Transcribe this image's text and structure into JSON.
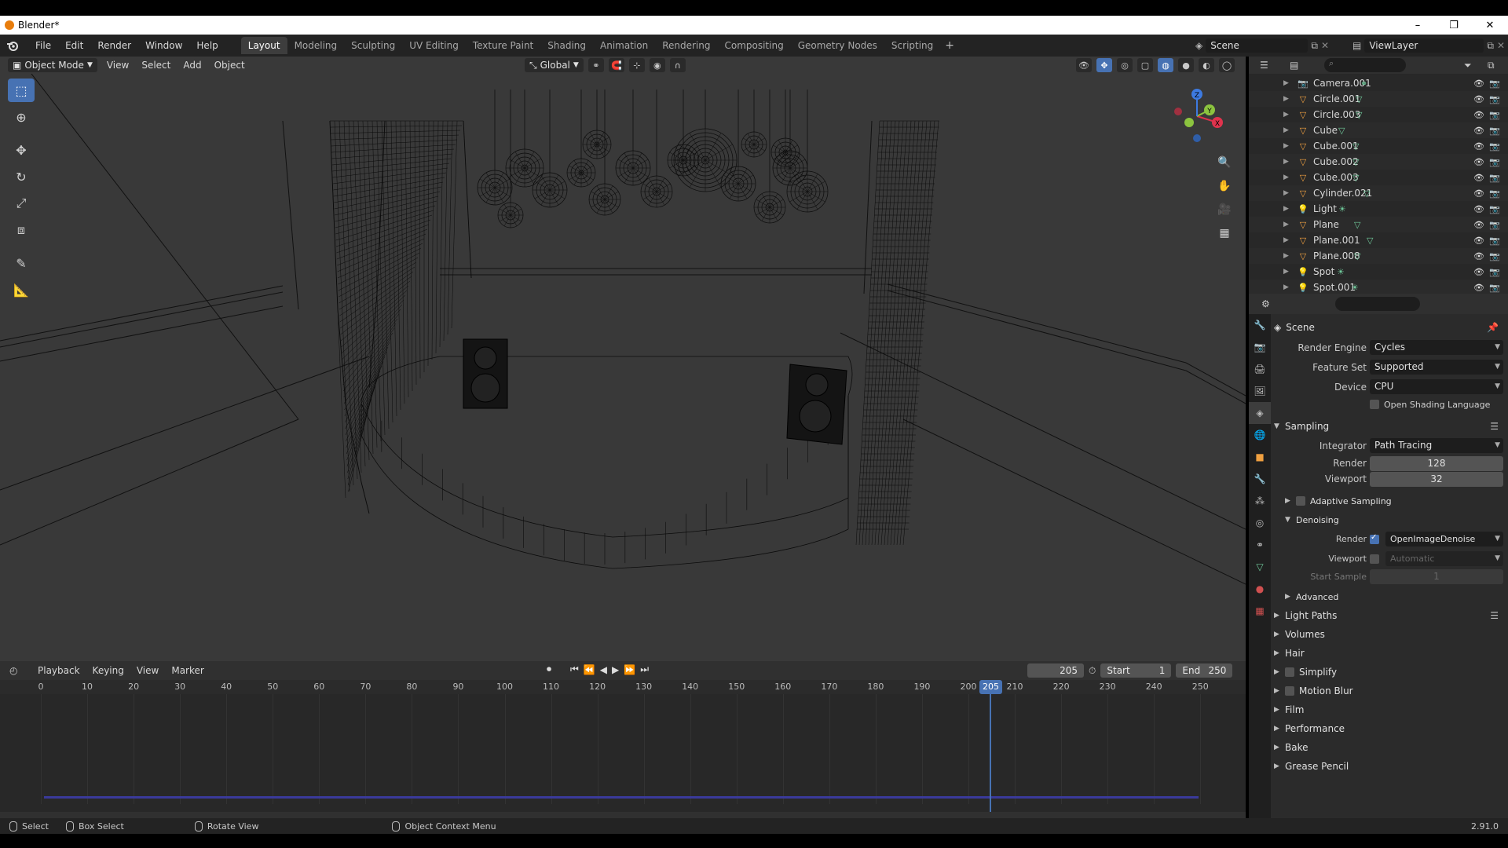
{
  "window": {
    "title": "Blender*",
    "controls": [
      "–",
      "❐",
      "✕"
    ]
  },
  "topbar": {
    "menu": [
      "File",
      "Edit",
      "Render",
      "Window",
      "Help"
    ],
    "workspaces": [
      "Layout",
      "Modeling",
      "Sculpting",
      "UV Editing",
      "Texture Paint",
      "Shading",
      "Animation",
      "Rendering",
      "Compositing",
      "Geometry Nodes",
      "Scripting"
    ],
    "active_workspace": "Layout",
    "add_label": "+",
    "scene": "Scene",
    "view_layer": "ViewLayer"
  },
  "viewport": {
    "mode": "Object Mode",
    "menu": [
      "View",
      "Select",
      "Add",
      "Object"
    ],
    "orientation": "Global",
    "gizmo_axes": {
      "x": "X",
      "y": "Y",
      "z": "Z"
    }
  },
  "outliner": {
    "search_placeholder": "",
    "items": [
      {
        "name": "Camera.001",
        "type": "camera"
      },
      {
        "name": "Circle.001",
        "type": "mesh"
      },
      {
        "name": "Circle.003",
        "type": "mesh"
      },
      {
        "name": "Cube",
        "type": "mesh"
      },
      {
        "name": "Cube.001",
        "type": "mesh"
      },
      {
        "name": "Cube.002",
        "type": "mesh"
      },
      {
        "name": "Cube.003",
        "type": "mesh"
      },
      {
        "name": "Cylinder.021",
        "type": "mesh"
      },
      {
        "name": "Light",
        "type": "light"
      },
      {
        "name": "Plane",
        "type": "mesh"
      },
      {
        "name": "Plane.001",
        "type": "mesh"
      },
      {
        "name": "Plane.008",
        "type": "mesh"
      },
      {
        "name": "Spot",
        "type": "light"
      },
      {
        "name": "Spot.001",
        "type": "light"
      }
    ]
  },
  "properties": {
    "context": "Scene",
    "render_engine_label": "Render Engine",
    "render_engine": "Cycles",
    "feature_set_label": "Feature Set",
    "feature_set": "Supported",
    "device_label": "Device",
    "device": "CPU",
    "osl_label": "Open Shading Language",
    "sampling": {
      "title": "Sampling",
      "integrator_label": "Integrator",
      "integrator": "Path Tracing",
      "render_label": "Render",
      "render_value": "128",
      "viewport_label": "Viewport",
      "viewport_value": "32",
      "adaptive_label": "Adaptive Sampling",
      "denoising": {
        "title": "Denoising",
        "render_label": "Render",
        "render_value": "OpenImageDenoise",
        "viewport_label": "Viewport",
        "viewport_value": "Automatic",
        "start_sample_label": "Start Sample",
        "start_sample_value": "1"
      },
      "advanced_label": "Advanced"
    },
    "panels": [
      "Light Paths",
      "Volumes",
      "Hair",
      "Simplify",
      "Motion Blur",
      "Film",
      "Performance",
      "Bake",
      "Grease Pencil"
    ]
  },
  "timeline": {
    "menu": [
      "Playback",
      "Keying",
      "View",
      "Marker"
    ],
    "current_frame": "205",
    "start_label": "Start",
    "start": "1",
    "end_label": "End",
    "end": "250",
    "ruler": [
      "0",
      "10",
      "20",
      "30",
      "40",
      "50",
      "60",
      "70",
      "80",
      "90",
      "100",
      "110",
      "120",
      "130",
      "140",
      "150",
      "160",
      "170",
      "180",
      "190",
      "200",
      "210",
      "220",
      "230",
      "240",
      "250"
    ]
  },
  "statusbar": {
    "select": "Select",
    "box_select": "Box Select",
    "rotate_view": "Rotate View",
    "context_menu": "Object Context Menu",
    "version": "2.91.0"
  },
  "colors": {
    "accent": "#4772b3",
    "viewport_bg": "#393939",
    "wire": "#0a0a0a",
    "x_axis": "#e0334d",
    "y_axis": "#8cc43f",
    "z_axis": "#3d7ae0",
    "mesh_icon": "#f0a040",
    "data_icon": "#6fc89a"
  }
}
